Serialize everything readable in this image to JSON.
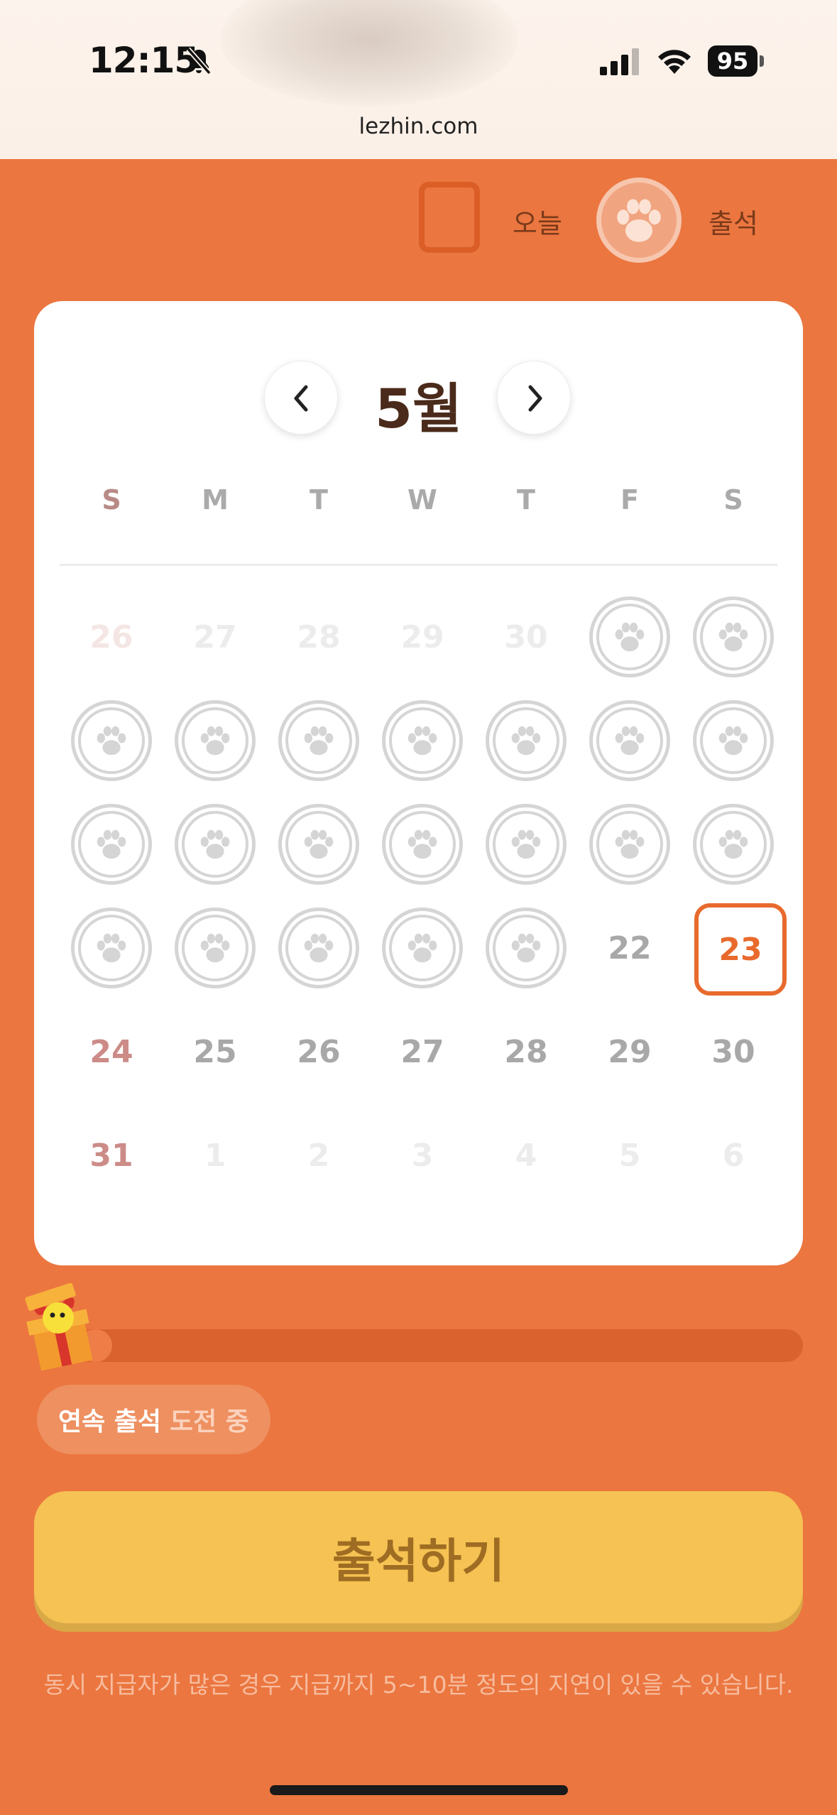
{
  "status_bar": {
    "time": "12:15",
    "battery": "95",
    "icons": [
      "bell-slash-icon",
      "cellular-signal-icon",
      "wifi-icon",
      "battery-icon"
    ]
  },
  "browser": {
    "url": "lezhin.com"
  },
  "legend": {
    "today_label": "오늘",
    "attended_label": "출석"
  },
  "calendar": {
    "month_title": "5월",
    "prev_icon": "chevron-left-icon",
    "next_icon": "chevron-right-icon",
    "weekdays": [
      "S",
      "M",
      "T",
      "W",
      "T",
      "F",
      "S"
    ],
    "weeks": [
      [
        {
          "label": "26",
          "state": "outside"
        },
        {
          "label": "27",
          "state": "outside"
        },
        {
          "label": "28",
          "state": "outside"
        },
        {
          "label": "29",
          "state": "outside"
        },
        {
          "label": "30",
          "state": "outside"
        },
        {
          "label": "",
          "state": "attended"
        },
        {
          "label": "",
          "state": "attended"
        }
      ],
      [
        {
          "label": "",
          "state": "attended"
        },
        {
          "label": "",
          "state": "attended"
        },
        {
          "label": "",
          "state": "attended"
        },
        {
          "label": "",
          "state": "attended"
        },
        {
          "label": "",
          "state": "attended"
        },
        {
          "label": "",
          "state": "attended"
        },
        {
          "label": "",
          "state": "attended"
        }
      ],
      [
        {
          "label": "",
          "state": "attended"
        },
        {
          "label": "",
          "state": "attended"
        },
        {
          "label": "",
          "state": "attended"
        },
        {
          "label": "",
          "state": "attended"
        },
        {
          "label": "",
          "state": "attended"
        },
        {
          "label": "",
          "state": "attended"
        },
        {
          "label": "",
          "state": "attended"
        }
      ],
      [
        {
          "label": "",
          "state": "attended"
        },
        {
          "label": "",
          "state": "attended"
        },
        {
          "label": "",
          "state": "attended"
        },
        {
          "label": "",
          "state": "attended"
        },
        {
          "label": "",
          "state": "attended"
        },
        {
          "label": "22",
          "state": "normal"
        },
        {
          "label": "23",
          "state": "today"
        }
      ],
      [
        {
          "label": "24",
          "state": "normal"
        },
        {
          "label": "25",
          "state": "normal"
        },
        {
          "label": "26",
          "state": "normal"
        },
        {
          "label": "27",
          "state": "normal"
        },
        {
          "label": "28",
          "state": "normal"
        },
        {
          "label": "29",
          "state": "normal"
        },
        {
          "label": "30",
          "state": "normal"
        }
      ],
      [
        {
          "label": "31",
          "state": "normal"
        },
        {
          "label": "1",
          "state": "outside"
        },
        {
          "label": "2",
          "state": "outside"
        },
        {
          "label": "3",
          "state": "outside"
        },
        {
          "label": "4",
          "state": "outside"
        },
        {
          "label": "5",
          "state": "outside"
        },
        {
          "label": "6",
          "state": "outside"
        }
      ]
    ]
  },
  "streak": {
    "progress_fraction": 0.05,
    "label_strong": "연속 출석",
    "label_weak": "도전 중",
    "icon": "gift-box-icon"
  },
  "attend_button": {
    "label": "출석하기"
  },
  "notice": "동시 지급자가 많은 경우 지급까지 5~10분 정도의 지연이 있을 수 있습니다.",
  "colors": {
    "background": "#EB7640",
    "today_accent": "#E86A2D",
    "button": "#F5C253",
    "button_text": "#9E6C22"
  }
}
